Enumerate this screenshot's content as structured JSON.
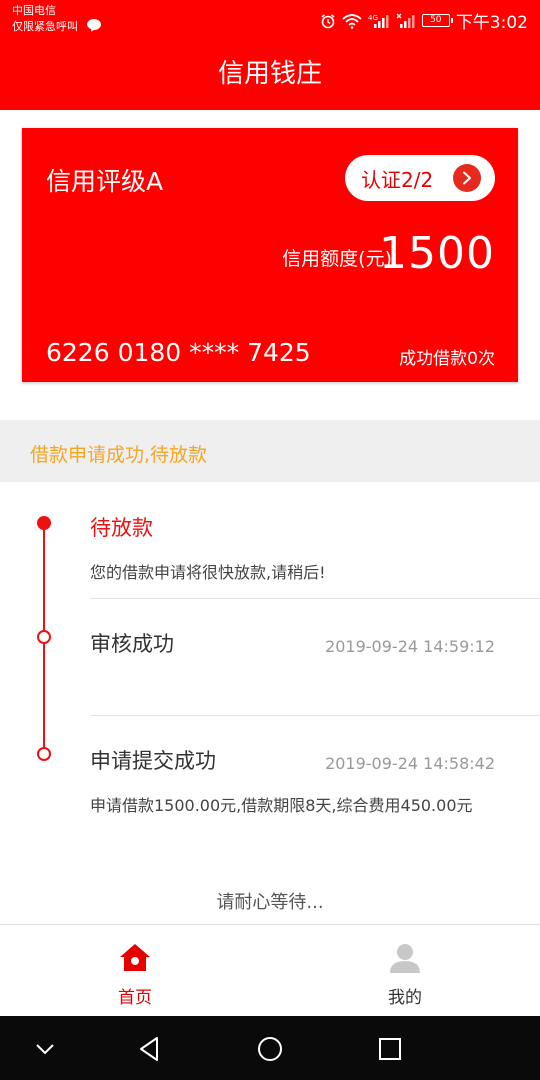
{
  "status_bar": {
    "carrier_line1": "中国电信",
    "carrier_line2": "仅限紧急呼叫",
    "battery": "50",
    "time": "下午3:02"
  },
  "header": {
    "title": "信用钱庄"
  },
  "card": {
    "rating": "信用评级A",
    "cert_label": "认证2/2",
    "limit_label": "信用额度(元)",
    "limit_value": "1500",
    "card_number": "6226 0180 **** 7425",
    "borrow_count": "成功借款0次"
  },
  "banner": {
    "text": "借款申请成功,待放款"
  },
  "timeline": {
    "steps": [
      {
        "title": "待放款",
        "desc": "您的借款申请将很快放款,请稍后!",
        "time": ""
      },
      {
        "title": "审核成功",
        "desc": "",
        "time": "2019-09-24 14:59:12"
      },
      {
        "title": "申请提交成功",
        "desc": "申请借款1500.00元,借款期限8天,综合费用450.00元",
        "time": "2019-09-24 14:58:42"
      }
    ],
    "footer": "请耐心等待..."
  },
  "bottom_nav": {
    "items": [
      {
        "label": "首页",
        "icon": "home-icon",
        "active": true
      },
      {
        "label": "我的",
        "icon": "user-icon",
        "active": false
      }
    ]
  },
  "colors": {
    "brand_red": "#ff0000",
    "banner_text": "#f5a623",
    "timeline_red": "#ee1111"
  }
}
